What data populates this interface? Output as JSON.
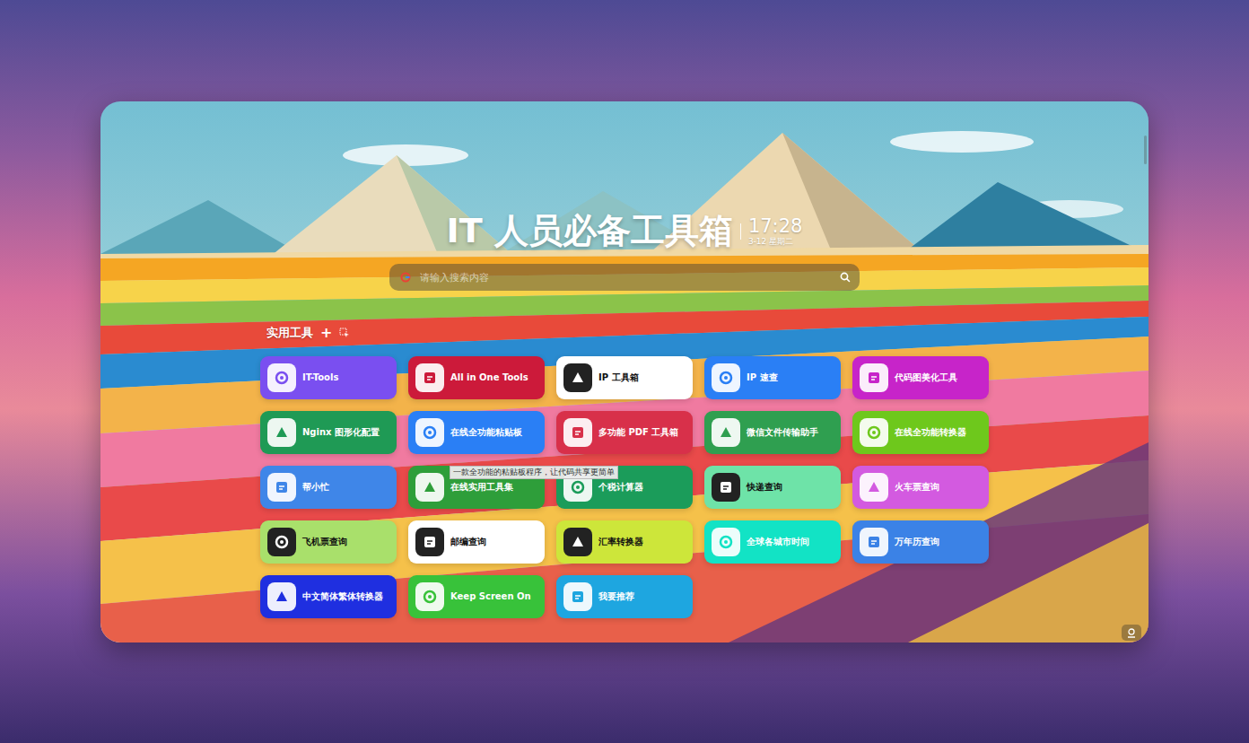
{
  "page": {
    "title": "IT 人员必备工具箱",
    "time": "17:28",
    "date": "3-12 星期二"
  },
  "search": {
    "placeholder": "请输入搜索内容"
  },
  "section": {
    "title": "实用工具",
    "add": "+"
  },
  "tools": [
    {
      "name": "IT-Tools",
      "color": "#7a4ff0"
    },
    {
      "name": "All in One Tools",
      "color": "#cc1a3a"
    },
    {
      "name": "IP 工具箱",
      "color": "#ffffff"
    },
    {
      "name": "IP 速查",
      "color": "#2a7ff5"
    },
    {
      "name": "代码图美化工具",
      "color": "#c724c9"
    },
    {
      "name": "Nginx 图形化配置",
      "color": "#1f9a55"
    },
    {
      "name": "在线全功能粘贴板",
      "color": "#2a7ff5"
    },
    {
      "name": "多功能 PDF 工具箱",
      "color": "#d8304a"
    },
    {
      "name": "微信文件传输助手",
      "color": "#2f9f50"
    },
    {
      "name": "在线全功能转换器",
      "color": "#6ec81c"
    },
    {
      "name": "帮小忙",
      "color": "#3f86e8"
    },
    {
      "name": "在线实用工具集",
      "color": "#2e9e3a"
    },
    {
      "name": "个税计算器",
      "color": "#1b9c5a"
    },
    {
      "name": "快递查询",
      "color": "#6ee3a8"
    },
    {
      "name": "火车票查询",
      "color": "#d35ae0"
    },
    {
      "name": "飞机票查询",
      "color": "#a9e06b"
    },
    {
      "name": "邮编查询",
      "color": "#ffffff"
    },
    {
      "name": "汇率转换器",
      "color": "#cde63a"
    },
    {
      "name": "全球各城市时间",
      "color": "#12e3c5"
    },
    {
      "name": "万年历查询",
      "color": "#3b82e6"
    },
    {
      "name": "中文简体繁体转换器",
      "color": "#1f2fe0"
    },
    {
      "name": "Keep Screen On",
      "color": "#38c23a"
    },
    {
      "name": "我要推荐",
      "color": "#1ea6e0"
    }
  ],
  "tooltip": {
    "text": "一款全功能的粘贴板程序，让代码共享更简单"
  }
}
